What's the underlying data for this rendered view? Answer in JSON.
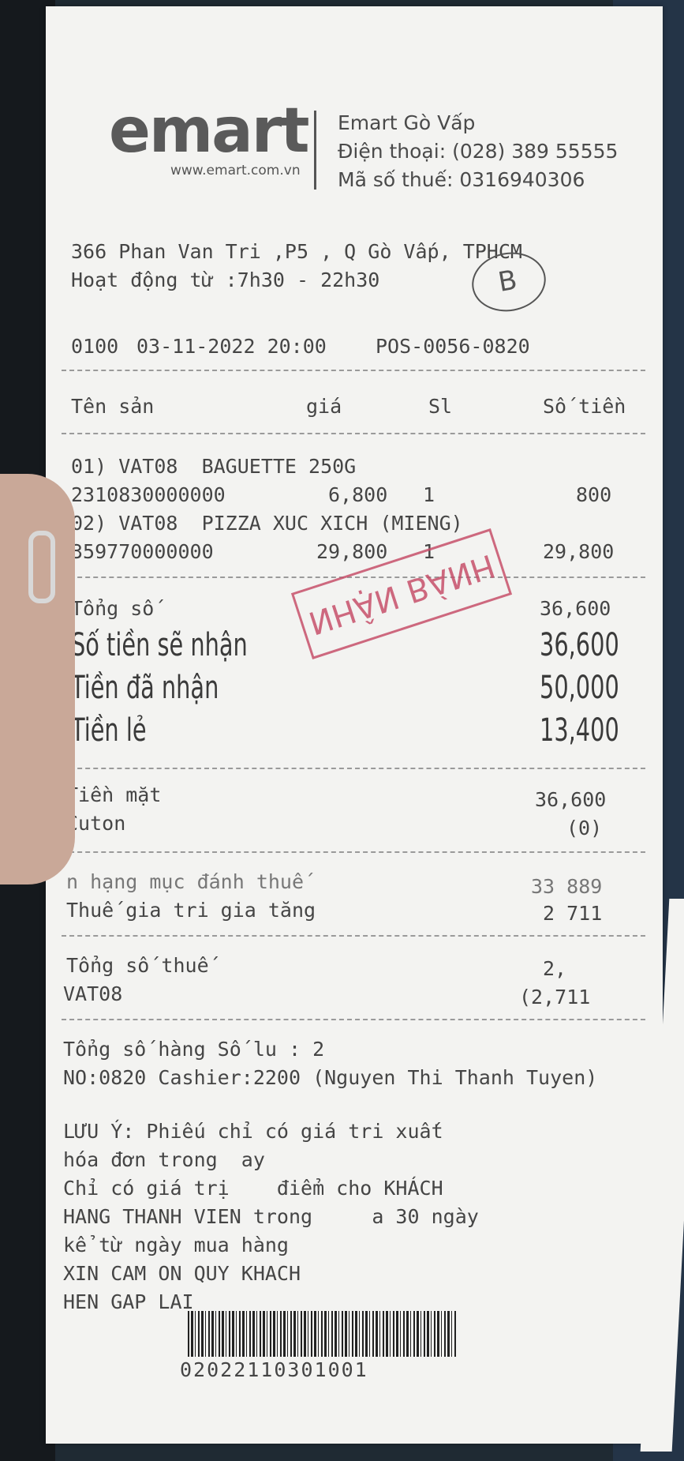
{
  "header": {
    "logo": "emart",
    "website": "www.emart.com.vn",
    "store_name": "Emart Gò Vấp",
    "phone": "Điện thoại: (028) 389 55555",
    "tax_code": "Mã số thuế: 0316940306"
  },
  "address": "366 Phan Van Tri ,P5 , Q Gò Vấp, TPHCM",
  "hours": "Hoạt động từ :7h30 - 22h30",
  "transaction": {
    "code": "0100",
    "datetime": "03-11-2022 20:00",
    "pos": "POS-0056-0820"
  },
  "columns": {
    "name": "Tên sản",
    "unit_price": "giá",
    "qty": "Sl",
    "amount": "Số tiền"
  },
  "items": [
    {
      "line": "01) VAT08  BAGUETTE 250G",
      "barcode": "2310830000000",
      "price": "6,800",
      "qty": "1",
      "amount": "800"
    },
    {
      "line": "02) VAT08  PIZZA XUC XICH (MIENG)",
      "barcode": "359770000000",
      "price": "29,800",
      "qty": "1",
      "amount": "29,800"
    }
  ],
  "totals": {
    "total_label": "Tổng số",
    "total_value": "36,600",
    "to_receive_label": "Số tiền sẽ nhận",
    "to_receive_value": "36,600",
    "received_label": "Tiền đã nhận",
    "received_value": "50,000",
    "change_label": "Tiền lẻ",
    "change_value": "13,400"
  },
  "stamp": "NHẬN BÁNH",
  "signature": "B",
  "payment": {
    "cash_label": "Tiền mặt",
    "cash_value": "36,600",
    "coupon_label": "Cuton",
    "coupon_value": "(0)"
  },
  "tax": {
    "taxable_label": "n hạng mục đánh thuế",
    "taxable_value": "33 889",
    "vat_label": "Thuế gia tri gia tăng",
    "vat_value": "2 711",
    "total_tax_label": "Tổng số thuế",
    "total_tax_value": "2,",
    "vat_code": "VAT08",
    "vat_code_value": "(2,711"
  },
  "summary": {
    "item_count": "Tổng số hàng Số lu : 2",
    "cashier": "NO:0820 Cashier:2200 (Nguyen Thi Thanh Tuyen)"
  },
  "notes": [
    "LƯU Ý: Phiếu chỉ có giá tri xuất",
    "hóa đơn trong  ay",
    "Chỉ có giá trị    điểm cho KHÁCH",
    "HANG THANH VIEN trong     a 30 ngày",
    "kể từ ngày mua hàng",
    "XIN CAM ON QUY KHACH",
    "HEN GAP LAI"
  ],
  "barcode_number": "02022110301001"
}
